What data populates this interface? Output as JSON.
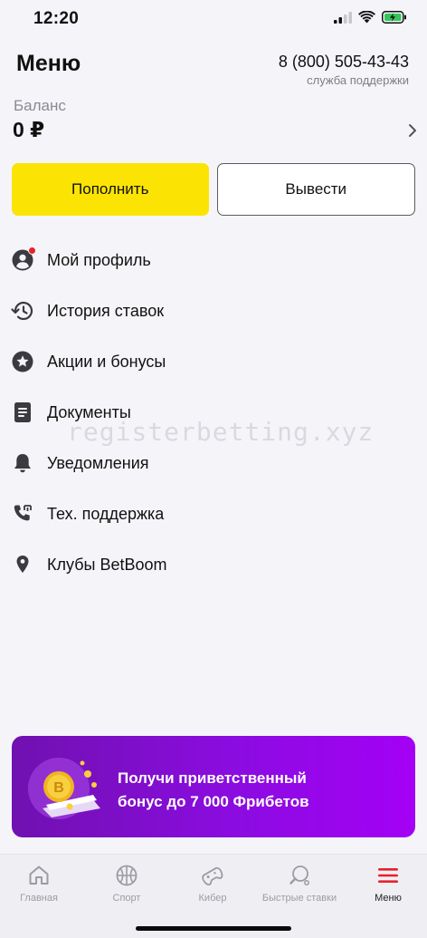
{
  "status": {
    "time": "12:20"
  },
  "header": {
    "title": "Меню",
    "phone": "8 (800) 505-43-43",
    "support": "служба поддержки"
  },
  "balance": {
    "label": "Баланс",
    "value": "0 ₽"
  },
  "actions": {
    "deposit": "Пополнить",
    "withdraw": "Вывести"
  },
  "menu": {
    "items": [
      {
        "label": "Мой профиль",
        "icon": "profile-icon"
      },
      {
        "label": "История ставок",
        "icon": "history-icon"
      },
      {
        "label": "Акции и бонусы",
        "icon": "star-icon"
      },
      {
        "label": "Документы",
        "icon": "document-icon"
      },
      {
        "label": "Уведомления",
        "icon": "bell-icon"
      },
      {
        "label": "Тех. поддержка",
        "icon": "phone-icon"
      },
      {
        "label": "Клубы BetBoom",
        "icon": "location-pin-icon"
      }
    ]
  },
  "watermark": "registerbetting.xyz",
  "banner": {
    "line1": "Получи приветственный",
    "line2": "бонус до 7 000 Фрибетов"
  },
  "tabs": [
    {
      "label": "Главная",
      "icon": "home-icon"
    },
    {
      "label": "Спорт",
      "icon": "basketball-icon"
    },
    {
      "label": "Кибер",
      "icon": "gamepad-icon"
    },
    {
      "label": "Быстрые ставки",
      "icon": "ping-pong-icon"
    },
    {
      "label": "Меню",
      "icon": "menu-icon"
    }
  ],
  "colors": {
    "accent_yellow": "#fbe403",
    "accent_red": "#e8212c",
    "banner_purple": "#8b0ce0"
  }
}
